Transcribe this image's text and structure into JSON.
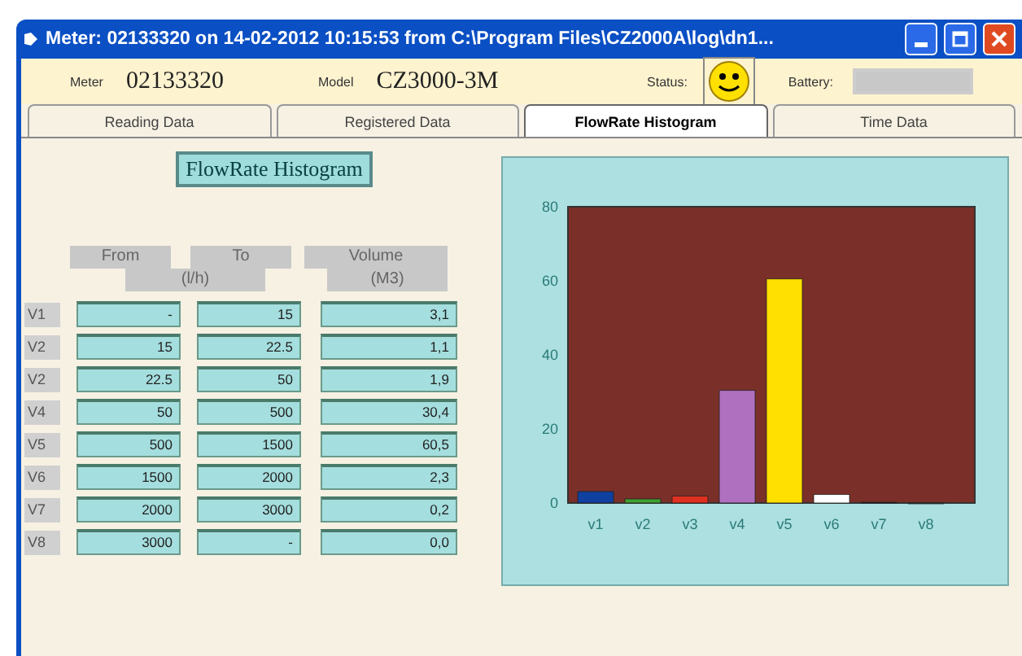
{
  "window": {
    "title": "Meter: 02133320 on 14-02-2012 10:15:53 from C:\\Program Files\\CZ2000A\\log\\dn1..."
  },
  "header": {
    "meter_label": "Meter",
    "meter": "02133320",
    "model_label": "Model",
    "model": "CZ3000-3M",
    "status_label": "Status:",
    "battery_label": "Battery:"
  },
  "tabs": [
    {
      "label": "Reading Data",
      "selected": false
    },
    {
      "label": "Registered Data",
      "selected": false
    },
    {
      "label": "FlowRate Histogram",
      "selected": true
    },
    {
      "label": "Time Data",
      "selected": false
    }
  ],
  "histogram": {
    "title": "FlowRate Histogram",
    "headers": {
      "from": "From",
      "to": "To",
      "flow_unit": "(l/h)",
      "volume": "Volume",
      "volume_unit": "(M3)"
    },
    "rows": [
      {
        "label": "V1",
        "from": "-",
        "to": "15",
        "volume": "3,1"
      },
      {
        "label": "V2",
        "from": "15",
        "to": "22.5",
        "volume": "1,1"
      },
      {
        "label": "V2",
        "from": "22.5",
        "to": "50",
        "volume": "1,9"
      },
      {
        "label": "V4",
        "from": "50",
        "to": "500",
        "volume": "30,4"
      },
      {
        "label": "V5",
        "from": "500",
        "to": "1500",
        "volume": "60,5"
      },
      {
        "label": "V6",
        "from": "1500",
        "to": "2000",
        "volume": "2,3"
      },
      {
        "label": "V7",
        "from": "2000",
        "to": "3000",
        "volume": "0,2"
      },
      {
        "label": "V8",
        "from": "3000",
        "to": "-",
        "volume": "0,0"
      }
    ],
    "chart_data": {
      "type": "bar",
      "categories": [
        "v1",
        "v2",
        "v3",
        "v4",
        "v5",
        "v6",
        "v7",
        "v8"
      ],
      "series": [
        {
          "values": [
            3.1,
            1.1,
            1.9,
            30.4,
            60.5,
            2.3,
            0.2,
            0.0
          ]
        }
      ],
      "colors": [
        "#1040a0",
        "#40a030",
        "#e03020",
        "#b070c0",
        "#ffe000",
        "#ffffff",
        "#202040",
        "#305040"
      ],
      "ylim": [
        0,
        80
      ],
      "yticks": [
        0,
        20,
        40,
        60,
        80
      ]
    }
  }
}
